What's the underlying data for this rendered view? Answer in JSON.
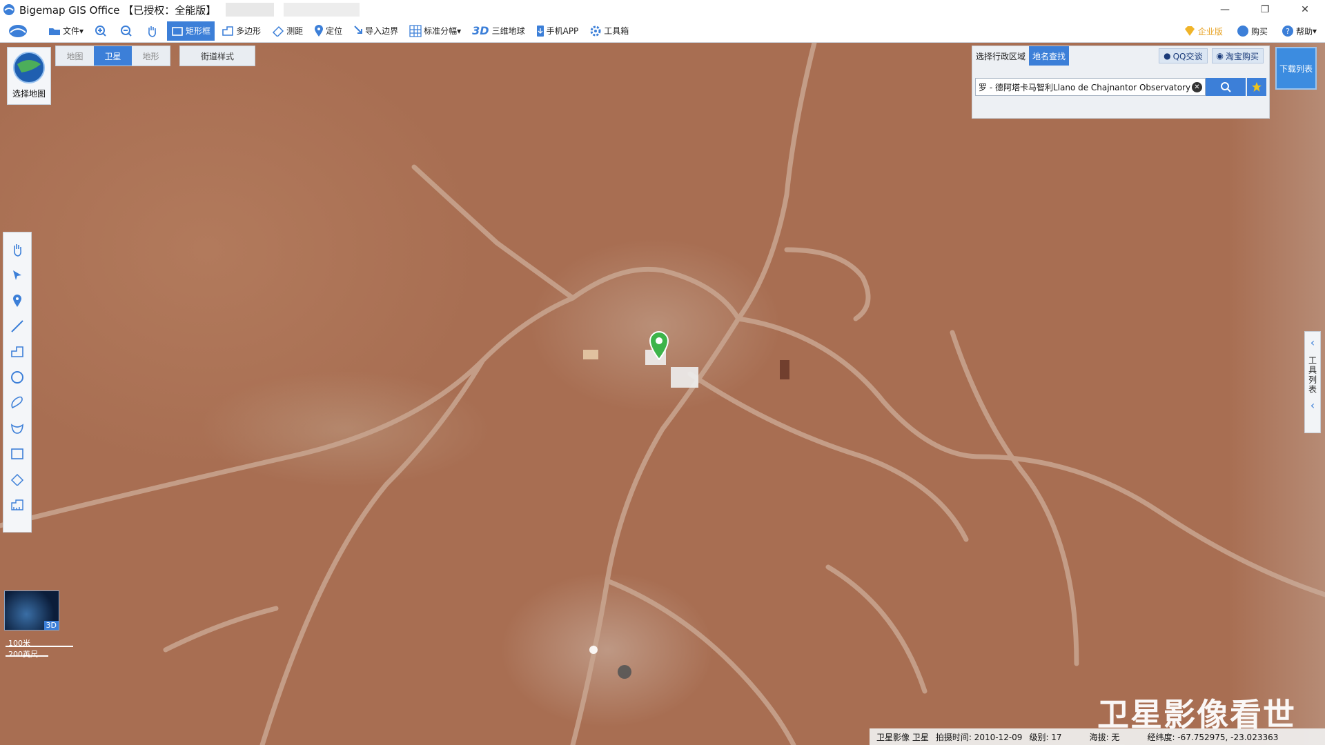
{
  "window": {
    "title": "Bigemap GIS Office 【已授权：全能版】",
    "minimize": "—",
    "restore": "❐",
    "close": "✕"
  },
  "toolbar": {
    "file": "文件",
    "zoom_in": "",
    "zoom_out": "",
    "pan": "",
    "rect_select": "矩形框",
    "polygon": "多边形",
    "measure": "测距",
    "locate": "定位",
    "import_boundary": "导入边界",
    "grid": "标准分幅",
    "three_d_label": "3D",
    "globe3d": "三维地球",
    "mobile": "手机APP",
    "toolbox": "工具箱",
    "enterprise": "企业版",
    "buy": "购买",
    "help": "帮助"
  },
  "layer_selector": {
    "label": "选择地图"
  },
  "map_type": {
    "map": "地图",
    "satellite": "卫星",
    "terrain": "地形",
    "street_style": "街道样式"
  },
  "search_panel": {
    "tab_region": "选择行政区域",
    "tab_place": "地名查找",
    "qq": "QQ交谈",
    "taobao": "淘宝购买",
    "query": "罗 - 德阿塔卡马智利Llano de Chajnantor Observatory",
    "clear": "✕"
  },
  "download_list": "下载列表",
  "right_panel": {
    "label": "工具列表",
    "arrow_top": "‹",
    "arrow_bottom": "‹"
  },
  "mini_globe": {
    "tag": "3D"
  },
  "scale": {
    "metric": "100米",
    "imperial": "200英尺"
  },
  "watermark": "卫星影像看世界",
  "status": {
    "imagery": "卫星影像 卫星",
    "capture_time": "拍摄时间: 2010-12-09",
    "level": "级别:   17",
    "altitude": "海拔: 无",
    "coords": "经纬度:   -67.752975, -23.023363"
  },
  "colors": {
    "accent": "#3c7fd8",
    "terrain": "#a9704f",
    "marker": "#3db44a"
  }
}
